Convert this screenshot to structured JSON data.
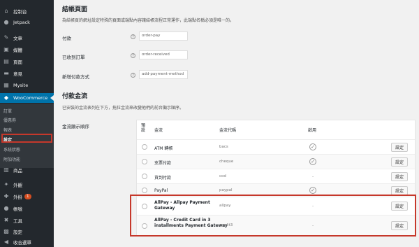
{
  "sidebar": {
    "items": [
      {
        "label": "控制台",
        "icon": "dashboard-icon",
        "glyph": "⌂"
      },
      {
        "label": "Jetpack",
        "icon": "jetpack-icon",
        "glyph": "●"
      },
      {
        "label": "文章",
        "icon": "pin-icon",
        "glyph": "✎"
      },
      {
        "label": "媒體",
        "icon": "media-icon",
        "glyph": "▣"
      },
      {
        "label": "頁面",
        "icon": "page-icon",
        "glyph": "▤"
      },
      {
        "label": "意見",
        "icon": "comment-icon",
        "glyph": "▬"
      },
      {
        "label": "Mysite",
        "icon": "mysite-icon",
        "glyph": "▦"
      },
      {
        "label": "WooCommerce",
        "icon": "woocommerce-icon",
        "glyph": "◆"
      },
      {
        "label": "商品",
        "icon": "products-icon",
        "glyph": "▥"
      },
      {
        "label": "外觀",
        "icon": "appearance-icon",
        "glyph": "✦"
      },
      {
        "label": "外掛",
        "icon": "plugin-icon",
        "glyph": "✚",
        "badge": "1"
      },
      {
        "label": "帳號",
        "icon": "users-icon",
        "glyph": "●"
      },
      {
        "label": "工具",
        "icon": "tools-icon",
        "glyph": "✖"
      },
      {
        "label": "設定",
        "icon": "settings-icon",
        "glyph": "▩"
      },
      {
        "label": "收合選單",
        "icon": "collapse-icon",
        "glyph": "◀"
      }
    ],
    "submenu": [
      "訂單",
      "優惠券",
      "報表",
      "設定",
      "系統狀態",
      "附加功能"
    ]
  },
  "checkout_section": {
    "title": "結帳頁面",
    "description": "為結帳頁的網址設定特殊的頁面或端點內容讓結帳流程正常運作，此端點名稱必須是唯一的。",
    "fields": [
      {
        "label": "付款",
        "value": "order-pay"
      },
      {
        "label": "已收到訂單",
        "value": "order-received"
      },
      {
        "label": "新增付款方式",
        "value": "add-payment-method"
      }
    ]
  },
  "gateways_section": {
    "title": "付款金流",
    "description": "已安裝的金流表列在下方，拖拉金流來改變他們的前台顯示順序。",
    "order_label": "金流顯示順序",
    "headers": {
      "default": "預設",
      "gateway": "金流",
      "gateway_id": "金流代碼",
      "enabled": "啟用"
    },
    "rows": [
      {
        "name": "ATM 轉帳",
        "id": "bacs",
        "enabled": true,
        "button": "設定"
      },
      {
        "name": "支票付款",
        "id": "cheque",
        "enabled": true,
        "button": "設定"
      },
      {
        "name": "貨到付款",
        "id": "cod",
        "enabled": false,
        "button": "設定"
      },
      {
        "name": "PayPal",
        "id": "paypal",
        "enabled": true,
        "button": "設定"
      },
      {
        "name": "AllPay - Allpay Payment Gateway",
        "id": "allpay",
        "enabled": false,
        "button": "設定"
      },
      {
        "name": "AllPay - Credit Card in 3 installments Payment Gateway",
        "id": "credit3",
        "enabled": false,
        "button": "設定"
      }
    ]
  },
  "colors": {
    "sidebar_bg": "#23282d",
    "active": "#0073aa",
    "highlight": "#c6382b"
  }
}
